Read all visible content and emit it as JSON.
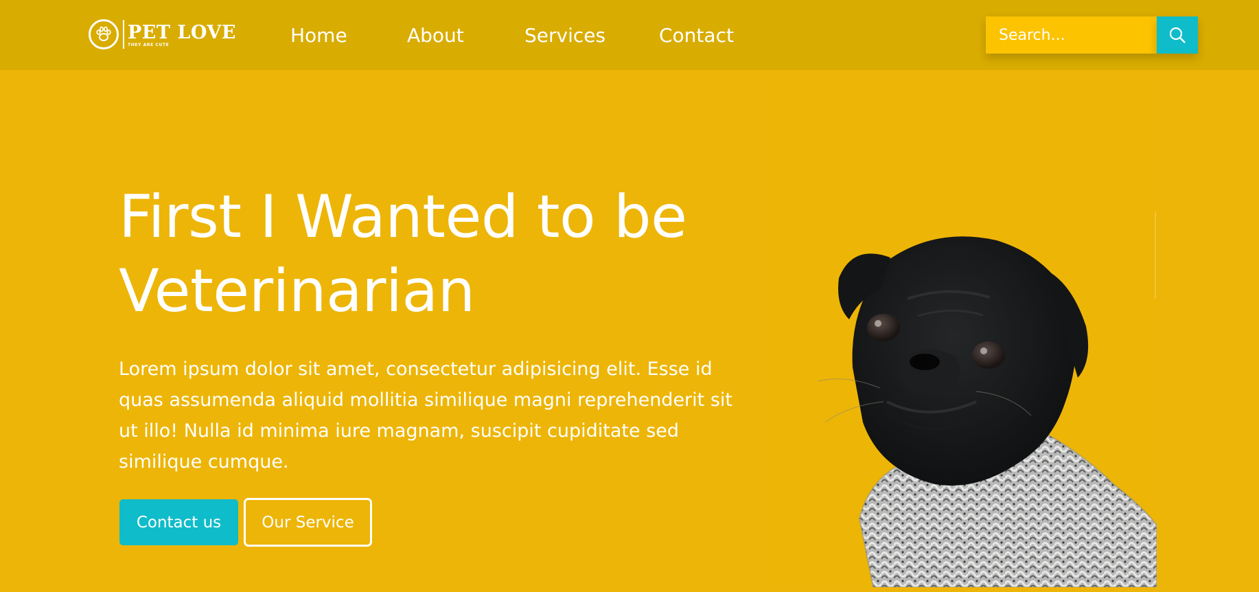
{
  "brand": {
    "name": "PET LOVE",
    "tagline": "THEY ARE CUTE",
    "logo_icon": "paw-icon"
  },
  "nav": {
    "items": [
      {
        "label": "Home"
      },
      {
        "label": "About"
      },
      {
        "label": "Services"
      },
      {
        "label": "Contact"
      }
    ]
  },
  "search": {
    "placeholder": "Search...",
    "button_icon": "search-icon"
  },
  "hero": {
    "title_line1": "First I Wanted to be",
    "title_line2": "Veterinarian",
    "text": "Lorem ipsum dolor sit amet, consectetur adipisicing elit. Esse id quas assumenda aliquid mollitia similique magni reprehenderit sit ut illo! Nulla id minima iure magnam, suscipit cupiditate sed similique cumque.",
    "primary_button": "Contact us",
    "secondary_button": "Our Service",
    "image": "black pug in knitted sweater"
  },
  "colors": {
    "header_bg": "#d9ac01",
    "hero_bg": "#edb507",
    "search_bg": "#fbc300",
    "accent": "#0fbcc9",
    "text": "#ffffff"
  }
}
